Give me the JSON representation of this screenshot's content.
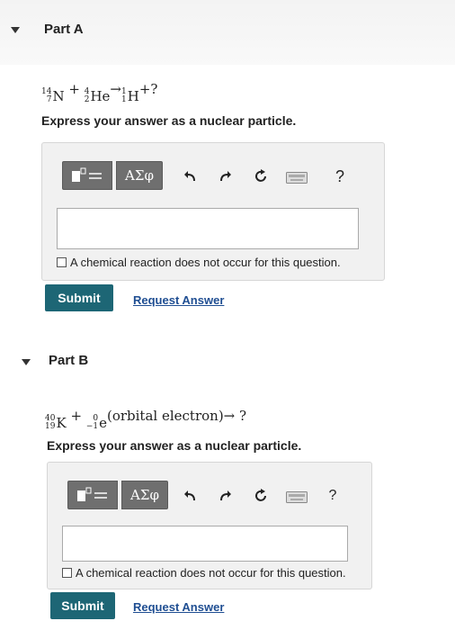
{
  "part_a": {
    "title": "Part A",
    "equation": {
      "n_mass": "14",
      "n_atomic": "7",
      "n_symbol": "N",
      "plus1": "+",
      "he_mass": "4",
      "he_atomic": "2",
      "he_symbol": "He",
      "arrow": "→",
      "h_mass": "1",
      "h_atomic": "1",
      "h_symbol": "H",
      "plus2": "+",
      "unknown": "?"
    },
    "instruction": "Express your answer as a nuclear particle.",
    "greek_label": "ΑΣφ",
    "help_label": "?",
    "checkbox_label": "A chemical reaction does not occur for this question.",
    "submit_label": "Submit",
    "request_label": "Request Answer"
  },
  "part_b": {
    "title": "Part B",
    "equation": {
      "k_mass": "40",
      "k_atomic": "19",
      "k_symbol": "K",
      "plus1": "+",
      "e_mass": "0",
      "e_atomic": "−1",
      "e_symbol": "e",
      "e_note": "(orbital electron)",
      "arrow": "→",
      "unknown": "?"
    },
    "instruction": "Express your answer as a nuclear particle.",
    "greek_label": "ΑΣφ",
    "help_label": "?",
    "checkbox_label": "A chemical reaction does not occur for this question.",
    "submit_label": "Submit",
    "request_label": "Request Answer"
  },
  "icons": [
    "caret-down-icon",
    "template-icon",
    "undo-icon",
    "redo-icon",
    "reset-icon",
    "keyboard-icon",
    "help-icon"
  ],
  "colors": {
    "submit": "#1d6675",
    "link": "#1f4e92",
    "toolbar": "#6f6f6f",
    "panel": "#f1f1f1"
  }
}
